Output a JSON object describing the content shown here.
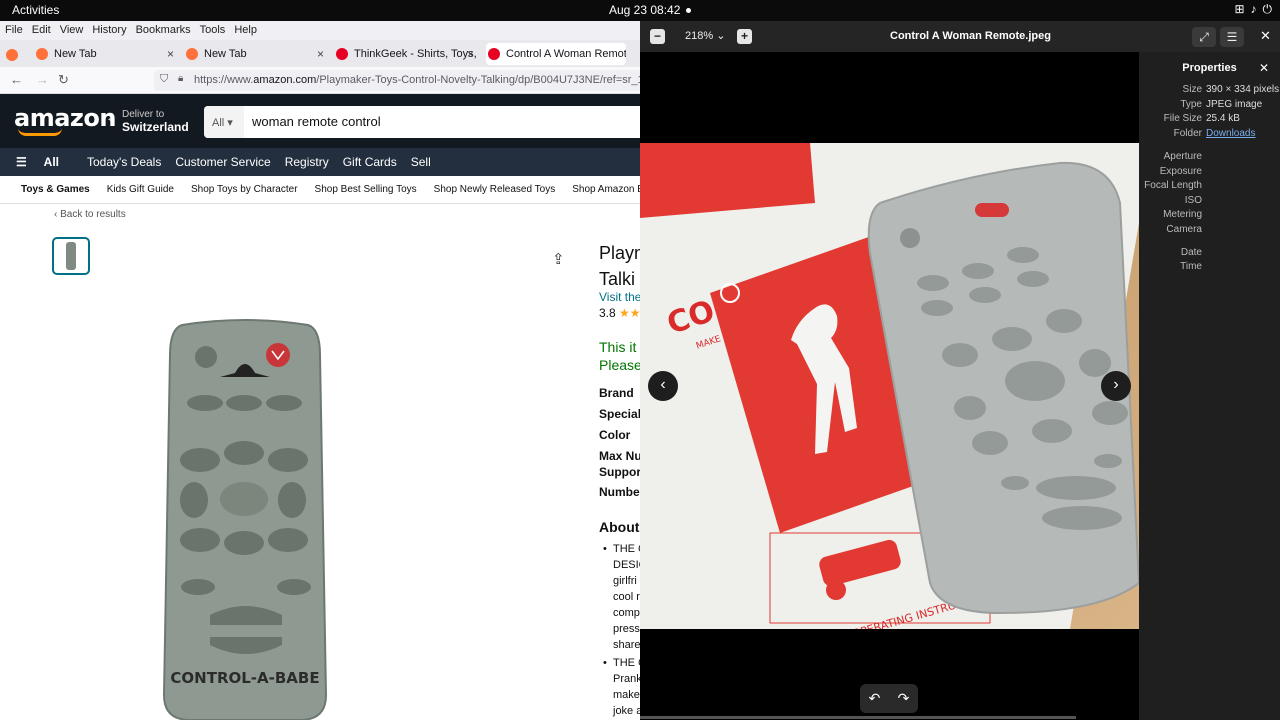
{
  "topbar": {
    "activities": "Activities",
    "clock": "Aug 23  08:42"
  },
  "firefox": {
    "menu": [
      "File",
      "Edit",
      "View",
      "History",
      "Bookmarks",
      "Tools",
      "Help"
    ],
    "tabs": [
      {
        "label": "New Tab",
        "favicon_color": "#ff7139"
      },
      {
        "label": "New Tab",
        "favicon_color": "#ff7139"
      },
      {
        "label": "ThinkGeek - Shirts, Toys,",
        "favicon_color": "#e60023"
      },
      {
        "label": "Control A Woman Remote",
        "favicon_color": "#e60023"
      }
    ],
    "url_prefix": "https://www.",
    "url_domain": "amazon.com",
    "url_rest": "/Playmaker-Toys-Control-Novelty-Talking/dp/B004U7J3NE/ref=sr_1_1?"
  },
  "amazon": {
    "logo": "amazon",
    "deliver_to": "Deliver to",
    "deliver_place": "Switzerland",
    "search_scope": "All",
    "search_query": "woman remote control",
    "nav": [
      "All",
      "Today's Deals",
      "Customer Service",
      "Registry",
      "Gift Cards",
      "Sell"
    ],
    "subnav": [
      "Toys & Games",
      "Kids Gift Guide",
      "Shop Toys by Character",
      "Shop Best Selling Toys",
      "Shop Newly Released Toys",
      "Shop Amazon Exclus"
    ],
    "back": "‹ Back to results",
    "title_l1": "Playm",
    "title_l2": "Talki",
    "visit": "Visit the",
    "rating_value": "3.8",
    "rating_stars": "★★",
    "avail_l1": "This it",
    "avail_l2": "Please",
    "specs": [
      "Brand",
      "Special",
      "Color",
      "Max Nu",
      "Support",
      "Number"
    ],
    "about": "About",
    "bullet1": [
      "THE C",
      "DESIG",
      "girlfri",
      "cool r",
      "comp",
      "press",
      "share"
    ],
    "bullet2": [
      "THE C",
      "Prank",
      "make",
      "joke a"
    ],
    "remote_brand": "CONTROL-A-BABE"
  },
  "viewer": {
    "zoom": "218%",
    "title": "Control A Woman Remote.jpeg",
    "photo_text": "CONTROL A WOMAN",
    "photo_sub": "MAKE HER DO WHAT YOU WANT",
    "photo_instr": "OPERATING INSTRUCTIONS",
    "properties": {
      "title": "Properties",
      "rows": [
        {
          "key": "Size",
          "value": "390 × 334 pixels"
        },
        {
          "key": "Type",
          "value": "JPEG image"
        },
        {
          "key": "File Size",
          "value": "25.4 kB"
        },
        {
          "key": "Folder",
          "value": "Downloads"
        },
        {
          "key": "Aperture",
          "value": ""
        },
        {
          "key": "Exposure",
          "value": ""
        },
        {
          "key": "Focal Length",
          "value": ""
        },
        {
          "key": "ISO",
          "value": ""
        },
        {
          "key": "Metering",
          "value": ""
        },
        {
          "key": "Camera",
          "value": ""
        },
        {
          "key": "Date",
          "value": ""
        },
        {
          "key": "Time",
          "value": ""
        }
      ]
    }
  }
}
